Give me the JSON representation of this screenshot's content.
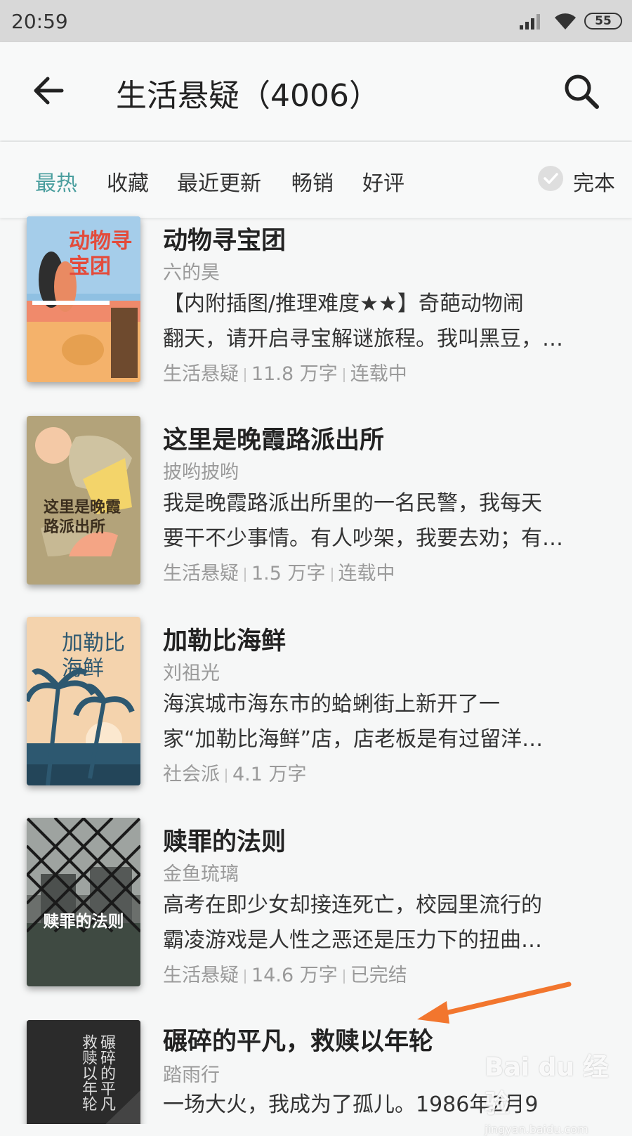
{
  "status_bar": {
    "time": "20:59",
    "battery": "55"
  },
  "header": {
    "title": "生活悬疑（4006）"
  },
  "tabs": [
    {
      "label": "最热",
      "active": true
    },
    {
      "label": "收藏"
    },
    {
      "label": "最近更新"
    },
    {
      "label": "畅销"
    },
    {
      "label": "好评"
    }
  ],
  "filter": {
    "label": "完本"
  },
  "books": [
    {
      "title": "动物寻宝团",
      "author": "六的昊",
      "desc_line1": "【内附插图/推理难度★★】奇葩动物闹",
      "desc_line2": "翻天，请开启寻宝解谜旅程。我叫黑豆，…",
      "category": "生活悬疑",
      "words": "11.8 万字",
      "status": "连载中",
      "cover_text": "动物寻宝团"
    },
    {
      "title": "这里是晚霞路派出所",
      "author": "披哟披哟",
      "desc_line1": "我是晚霞路派出所里的一名民警，我每天",
      "desc_line2": "要干不少事情。有人吵架，我要去劝；有…",
      "category": "生活悬疑",
      "words": "1.5 万字",
      "status": "连载中",
      "cover_text": "这里是晚霞路派出所"
    },
    {
      "title": "加勒比海鲜",
      "author": "刘祖光",
      "desc_line1": "海滨城市海东市的蛤蜊街上新开了一",
      "desc_line2": "家“加勒比海鲜”店，店老板是有过留洋…",
      "category": "社会派",
      "words": "4.1 万字",
      "cover_text": "加勒比海鲜"
    },
    {
      "title": "赎罪的法则",
      "author": "金鱼琉璃",
      "desc_line1": "高考在即少女却接连死亡，校园里流行的",
      "desc_line2": "霸凌游戏是人性之恶还是压力下的扭曲…",
      "category": "生活悬疑",
      "words": "14.6 万字",
      "status": "已完结",
      "cover_text": "赎罪的法则"
    },
    {
      "title": "碾碎的平凡，救赎以年轮",
      "author": "踏雨行",
      "desc_line1": "一场大火，我成为了孤儿。1986年2月9",
      "cover_text": "碾碎的平凡 救赎以年轮"
    }
  ],
  "watermark": {
    "brand": "Bai du 经验",
    "url": "jingyan.baidu.com"
  },
  "colors": {
    "accent": "#4a9e9e",
    "annotation_arrow": "#f2762e"
  }
}
